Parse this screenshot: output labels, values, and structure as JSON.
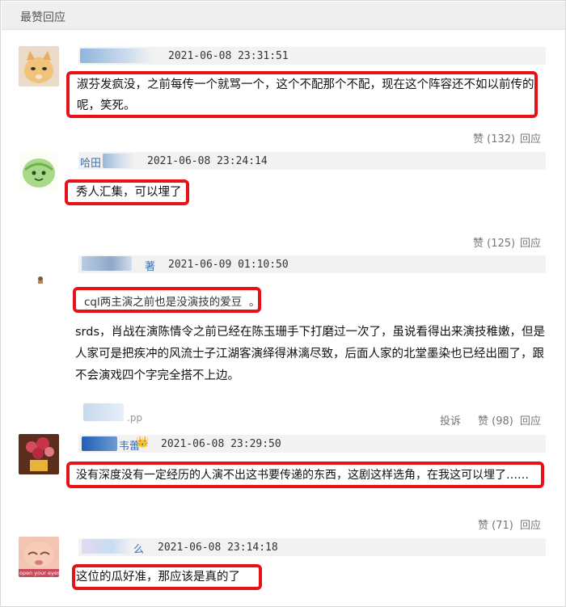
{
  "header": {
    "title": "最赞回应"
  },
  "comments": [
    {
      "time": "2021-06-08 23:31:51",
      "text_line1": "淑芬发疯没，之前每传一个就骂一个，这个不配那个不配，现在这个阵容还不如以前传的",
      "text_line2": "呢，笑死。",
      "like": "赞 (132)",
      "reply": "回应"
    },
    {
      "name": "哈田",
      "time": "2021-06-08 23:24:14",
      "text": "秀人汇集，可以埋了",
      "like": "赞 (125)",
      "reply": "回应"
    },
    {
      "name_suffix": "著",
      "time": "2021-06-09 01:10:50",
      "quote": "cql两主演之前也是没演技的爱豆",
      "quote_tail": "。",
      "body_line1": "srds，肖战在演陈情令之前已经在陈玉珊手下打磨过一次了，虽说看得出来演技稚嫩，但是",
      "body_line2": "人家可是把疾冲的风流士子江湖客演绎得淋漓尽致，后面人家的北堂墨染也已经出圈了，跟",
      "body_line3": "不会演戏四个字完全搭不上边。",
      "source": ".pp",
      "report": "投诉",
      "like": "赞 (98)",
      "reply": "回应"
    },
    {
      "name": "韦蕾",
      "crown": "👑",
      "time": "2021-06-08 23:29:50",
      "text": "没有深度没有一定经历的人演不出这书要传递的东西，这剧这样选角，在我这可以埋了……",
      "like": "赞 (71)",
      "reply": "回应"
    },
    {
      "name": "么",
      "time": "2021-06-08 23:14:18",
      "text": "这位的瓜好准，那应该是真的了",
      "avatar_caption": "open your eyes"
    }
  ],
  "colors": {
    "highlight": "#e8111a",
    "name": "#3c6fb0",
    "meta_bg": "#f2f2f2"
  }
}
